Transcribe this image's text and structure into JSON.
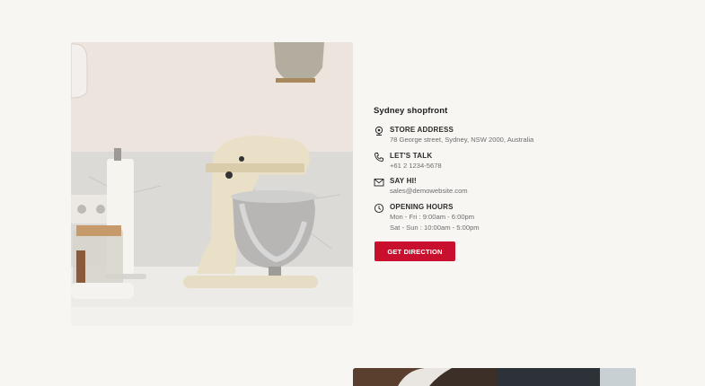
{
  "store": {
    "title": "Sydney shopfront",
    "address_label": "STORE ADDRESS",
    "address_value": "78 George street, Sydney, NSW 2000, Australia",
    "talk_label": "LET'S TALK",
    "phone_value": "+61 2 1234-5678",
    "sayhi_label": "SAY HI!",
    "email_value": "sales@demowebsite.com",
    "hours_label": "OPENING HOURS",
    "hours_weekday": "Mon - Fri : 9:00am - 6:00pm",
    "hours_weekend": "Sat - Sun : 10:00am - 5:00pm"
  },
  "button": {
    "label": "GET DIRECTION"
  },
  "icons": {
    "address": "location-pin-icon",
    "talk": "phone-icon",
    "sayhi": "mail-icon",
    "hours": "clock-icon"
  },
  "colors": {
    "accent": "#c8102e",
    "background": "#f8f6f3"
  }
}
